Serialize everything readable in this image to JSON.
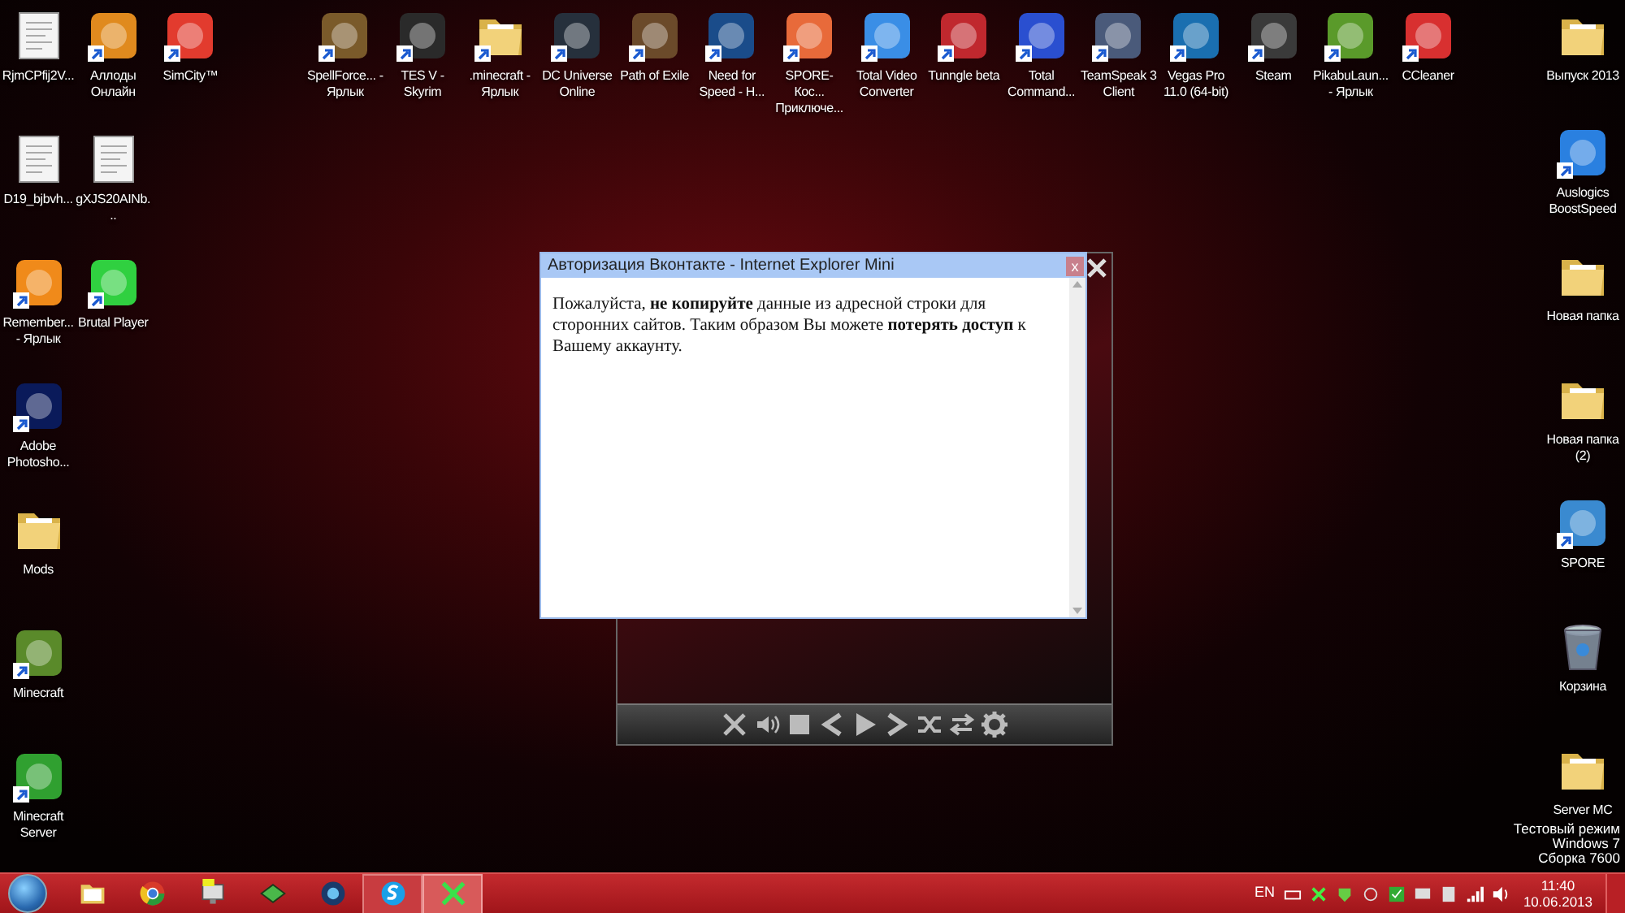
{
  "desktop": {
    "top_row": [
      {
        "label": "RjmCPfij2V...",
        "kind": "image-file",
        "shortcut": false
      },
      {
        "label": "Аллоды Онлайн",
        "kind": "app",
        "shortcut": true,
        "color": "#e08a1e"
      },
      {
        "label": "SimCity™",
        "kind": "app",
        "shortcut": true,
        "color": "#e23b2e"
      },
      {
        "label": "SpellForce... - Ярлык",
        "kind": "app",
        "shortcut": true,
        "color": "#7a5a2a"
      },
      {
        "label": "TES V - Skyrim",
        "kind": "app",
        "shortcut": true,
        "color": "#2a2a2a"
      },
      {
        "label": ".minecraft - Ярлык",
        "kind": "folder",
        "shortcut": true
      },
      {
        "label": "DC Universe Online",
        "kind": "app",
        "shortcut": true,
        "color": "#26303c"
      },
      {
        "label": "Path of Exile",
        "kind": "app",
        "shortcut": true,
        "color": "#6b4a2a"
      },
      {
        "label": "Need for Speed - H...",
        "kind": "app",
        "shortcut": true,
        "color": "#1a4c8a"
      },
      {
        "label": "SPORE-Кос... Приключе...",
        "kind": "app",
        "shortcut": true,
        "color": "#e86a3a"
      },
      {
        "label": "Total Video Converter",
        "kind": "app",
        "shortcut": true,
        "color": "#3a8ee6"
      },
      {
        "label": "Tunngle beta",
        "kind": "app",
        "shortcut": true,
        "color": "#c0282e"
      },
      {
        "label": "Total Command...",
        "kind": "app",
        "shortcut": true,
        "color": "#2a4fd0"
      },
      {
        "label": "TeamSpeak 3 Client",
        "kind": "app",
        "shortcut": true,
        "color": "#4a5a7a"
      },
      {
        "label": "Vegas Pro 11.0 (64-bit)",
        "kind": "app",
        "shortcut": true,
        "color": "#1a6fb0"
      },
      {
        "label": "Steam",
        "kind": "app",
        "shortcut": true,
        "color": "#3a3a3a"
      },
      {
        "label": "PikabuLaun... - Ярлык",
        "kind": "app",
        "shortcut": true,
        "color": "#5a9a2a"
      },
      {
        "label": "CCleaner",
        "kind": "app",
        "shortcut": true,
        "color": "#d83030"
      },
      {
        "label": "Выпуск 2013",
        "kind": "folder",
        "shortcut": false
      }
    ],
    "left_rows": [
      [
        {
          "label": "D19_bjbvh...",
          "kind": "image-file",
          "shortcut": false
        },
        {
          "label": "gXJS20AINb...",
          "kind": "image-file",
          "shortcut": false
        }
      ],
      [
        {
          "label": "Remember... - Ярлык",
          "kind": "app",
          "shortcut": true,
          "color": "#f08a1a"
        },
        {
          "label": "Brutal Player",
          "kind": "app",
          "shortcut": true,
          "color": "#30d040"
        }
      ],
      [
        {
          "label": "Adobe Photosho...",
          "kind": "app",
          "shortcut": true,
          "color": "#0a1a5a"
        }
      ],
      [
        {
          "label": "Mods",
          "kind": "folder",
          "shortcut": false
        }
      ],
      [
        {
          "label": "Minecraft",
          "kind": "app",
          "shortcut": true,
          "color": "#5a8a2a"
        }
      ],
      [
        {
          "label": "Minecraft Server",
          "kind": "app",
          "shortcut": true,
          "color": "#30a030"
        }
      ]
    ],
    "right_column": [
      {
        "label": "Auslogics BoostSpeed",
        "kind": "app",
        "shortcut": true,
        "color": "#2a80e0"
      },
      {
        "label": "Новая папка",
        "kind": "folder",
        "shortcut": false
      },
      {
        "label": "Новая папка (2)",
        "kind": "folder",
        "shortcut": false
      },
      {
        "label": "SPORE",
        "kind": "app",
        "shortcut": true,
        "color": "#3a8ad0"
      },
      {
        "label": "Корзина",
        "kind": "recycle-bin",
        "shortcut": false
      },
      {
        "label": "Server MC",
        "kind": "folder",
        "shortcut": false
      }
    ],
    "test_mode_notice": [
      "Тестовый режим",
      "Windows 7",
      "Сборка 7600"
    ]
  },
  "dialog": {
    "title": "Авторизация Вконтакте - Internet Explorer Mini",
    "close_label": "x",
    "message": "Пожалуйста, **не копируйте** данные из адресной строки для сторонних сайтов. Таким образом Вы можете **потерять доступ** к Вашему аккаунту."
  },
  "taskbar": {
    "buttons": [
      {
        "running": false
      },
      {
        "running": false
      },
      {
        "running": false
      },
      {
        "running": false
      },
      {
        "running": false
      },
      {
        "running": true,
        "selected": false
      },
      {
        "running": true,
        "selected": true
      }
    ],
    "language": "EN",
    "time": "11:40",
    "date": "10.06.2013"
  }
}
